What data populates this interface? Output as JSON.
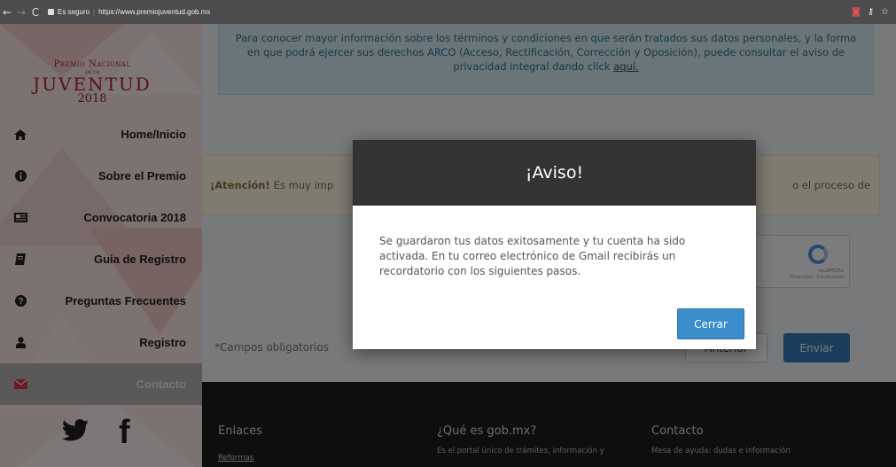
{
  "browser": {
    "secure_label": "Es seguro",
    "url": "https://www.premiojuventud.gob.mx"
  },
  "logo": {
    "line1": "Premio Nacional",
    "line2": "de la",
    "line3": "Juventud",
    "year": "2018"
  },
  "sidebar": {
    "items": [
      {
        "label": "Home/Inicio",
        "icon": "home-icon"
      },
      {
        "label": "Sobre el Premio",
        "icon": "info-icon"
      },
      {
        "label": "Convocatoria 2018",
        "icon": "newspaper-icon"
      },
      {
        "label": "Guia de Registro",
        "icon": "book-icon"
      },
      {
        "label": "Preguntas Frecuentes",
        "icon": "question-icon"
      },
      {
        "label": "Registro",
        "icon": "user-icon"
      },
      {
        "label": "Contacto",
        "icon": "envelope-icon",
        "active": true
      }
    ],
    "social": {
      "twitter": "twitter-icon",
      "facebook": "facebook-icon"
    }
  },
  "main": {
    "privacy_text": "Para conocer mayor información sobre los términos y condiciones en que serán tratados sus datos personales, y la forma en que podrá ejercer sus derechos ARCO (Acceso, Rectificación, Corrección y Oposición), puede consultar el aviso de privacidad integral dando click",
    "privacy_link": "aquí.",
    "attention_label": "¡Atención!",
    "attention_text": "Es muy imp",
    "attention_tail": "o el proceso de",
    "recaptcha_label": "reCAPTCHA",
    "recaptcha_sub": "Privacidad · Condiciones",
    "required_note": "*Campos obligatorios",
    "prev_button": "Anterior",
    "send_button": "Enviar"
  },
  "footer": {
    "col1": {
      "title": "Enlaces",
      "link": "Reformas"
    },
    "col2": {
      "title": "¿Qué es gob.mx?",
      "text": "Es el portal único de trámites, información y"
    },
    "col3": {
      "title": "Contacto",
      "text": "Mesa de ayuda: dudas e información"
    }
  },
  "modal": {
    "title": "¡Aviso!",
    "message": "Se guardaron tus datos exitosamente y tu cuenta ha sido activada. En tu correo electrónico de Gmail recibirás un recordatorio con los siguientes pasos.",
    "close_button": "Cerrar"
  }
}
